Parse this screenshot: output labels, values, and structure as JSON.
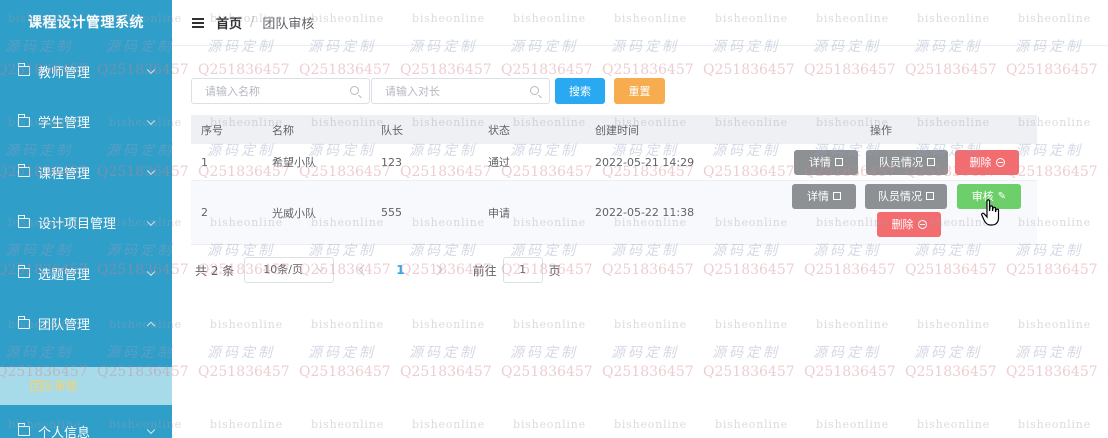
{
  "sidebar": {
    "title": "课程设计管理系统",
    "items": [
      {
        "label": "教师管理"
      },
      {
        "label": "学生管理"
      },
      {
        "label": "课程管理"
      },
      {
        "label": "设计项目管理"
      },
      {
        "label": "选题管理"
      },
      {
        "label": "团队管理"
      }
    ],
    "active_sub": "团队审核",
    "last_item": "个人信息"
  },
  "header": {
    "home": "首页",
    "separator": "/",
    "current": "团队审核"
  },
  "search": {
    "name_placeholder": "请输入名称",
    "leader_placeholder": "请输入对长",
    "search_label": "搜索",
    "reset_label": "重置"
  },
  "table": {
    "columns": [
      "序号",
      "名称",
      "队长",
      "状态",
      "创建时间",
      "操作"
    ],
    "rows": [
      {
        "no": "1",
        "name": "希望小队",
        "leader": "123",
        "status": "通过",
        "created": "2022-05-21 14:29"
      },
      {
        "no": "2",
        "name": "光威小队",
        "leader": "555",
        "status": "申请",
        "created": "2022-05-22 11:38"
      }
    ],
    "actions": {
      "detail": "详情",
      "members": "队员情况",
      "delete": "删除",
      "review": "审核"
    }
  },
  "pagination": {
    "total": "共 2 条",
    "page_size": "10条/页",
    "current_page": "1",
    "goto_label": "前往",
    "goto_value": "1",
    "goto_unit": "页"
  },
  "watermark": {
    "line_a": "bisheonline",
    "line_b": "源码定制",
    "line_c": "Q251836457"
  },
  "colors": {
    "sidebar_bg": "#2f9ec9",
    "active_sub_bg": "#a7dbe9",
    "active_sub_text": "#f7d26b",
    "primary": "#29a9f2",
    "warning": "#f7ad4f",
    "danger": "#f36c6f",
    "success": "#6dcf6a",
    "neutral": "#8e9194"
  }
}
